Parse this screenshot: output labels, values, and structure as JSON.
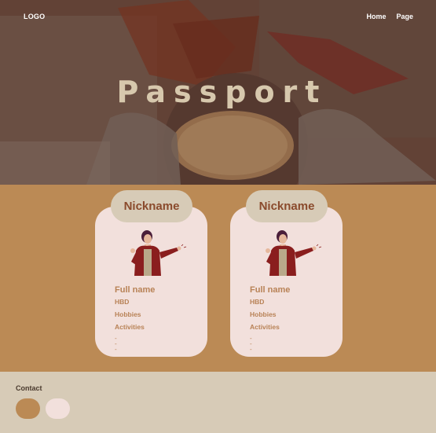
{
  "nav": {
    "logo": "LOGO",
    "links": [
      "Home",
      "Page"
    ]
  },
  "hero": {
    "title": "Passport"
  },
  "cards": [
    {
      "nickname": "Nickname",
      "full_name": "Full name",
      "fields": [
        "HBD",
        "Hobbies",
        "Activities"
      ],
      "dashes": [
        "-",
        "-",
        "-"
      ]
    },
    {
      "nickname": "Nickname",
      "full_name": "Full name",
      "fields": [
        "HBD",
        "Hobbies",
        "Activities"
      ],
      "dashes": [
        "-",
        "-",
        "-"
      ]
    }
  ],
  "footer": {
    "contact_label": "Contact"
  },
  "colors": {
    "hero_overlay": "#5a3b32",
    "title": "#d7c8ad",
    "cards_bg": "#bb8a55",
    "card_bg": "#f2e0dc",
    "nickname_pill": "#d7cbb7",
    "nickname_text": "#8a4a2c",
    "footer_bg": "#d7cbb7",
    "contact_circle_1": "#bb8a55",
    "contact_circle_2": "#f2e0dc"
  }
}
